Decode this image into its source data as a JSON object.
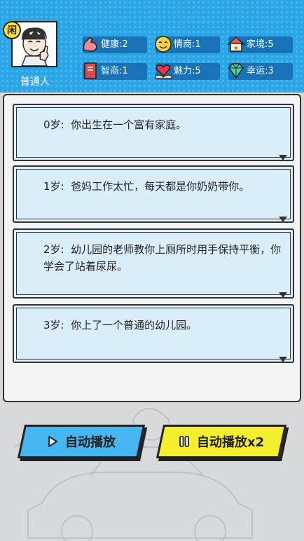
{
  "player": {
    "badge": "闲",
    "name": "普通人"
  },
  "stats": [
    {
      "label": "健康",
      "value": "2",
      "icon": "muscle-arm-icon"
    },
    {
      "label": "情商",
      "value": "1",
      "icon": "smiling-face-icon"
    },
    {
      "label": "家境",
      "value": "5",
      "icon": "house-icon"
    },
    {
      "label": "智商",
      "value": "1",
      "icon": "book-icon"
    },
    {
      "label": "魅力",
      "value": "5",
      "icon": "heart-hand-icon"
    },
    {
      "label": "幸运",
      "value": "3",
      "icon": "diamond-icon"
    }
  ],
  "log": [
    {
      "age": "0岁",
      "text": "你出生在一个富有家庭。"
    },
    {
      "age": "1岁",
      "text": "爸妈工作太忙，每天都是你奶奶带你。"
    },
    {
      "age": "2岁",
      "text": "幼儿园的老师教你上厕所时用手保持平衡，你学会了站着尿尿。"
    },
    {
      "age": "3岁",
      "text": "你上了一个普通的幼儿园。"
    }
  ],
  "buttons": {
    "auto_play": "自动播放",
    "auto_play_x2": "自动播放x2"
  },
  "colors": {
    "header_blue": "#2aa5e6",
    "stat_pill": "#1a72b6",
    "entry_bg": "#daeef9",
    "button_blue": "#46b6ee",
    "button_yellow": "#f4ef2c"
  }
}
